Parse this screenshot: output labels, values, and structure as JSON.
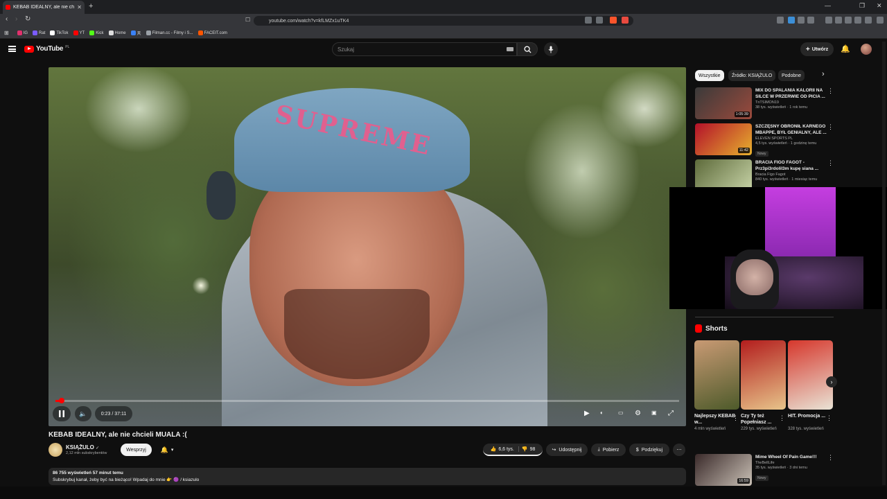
{
  "browser": {
    "tab_title": "KEBAB IDEALNY, ale nie chcie",
    "new_tab": "+",
    "url": "youtube.com/watch?v=kfLMZx1uTK4",
    "win_controls": [
      "—",
      "❐",
      "✕"
    ],
    "bookmarks": [
      {
        "label": "IG",
        "color": "#e1306c"
      },
      {
        "label": "Rat",
        "color": "#7b5cff"
      },
      {
        "label": "TikTok",
        "color": "#ffffff"
      },
      {
        "label": "YT",
        "color": "#ff0000"
      },
      {
        "label": "Kick",
        "color": "#53fc18"
      },
      {
        "label": "Home",
        "color": "#dddddd"
      },
      {
        "label": "天",
        "color": "#3b82f6"
      },
      {
        "label": "Filman.cc - Filmy i S...",
        "color": "#9aa0a6"
      },
      {
        "label": "FACEIT.com",
        "color": "#ff5500"
      }
    ]
  },
  "youtube": {
    "logo_text": "YouTube",
    "region": "PL",
    "search_placeholder": "Szukaj",
    "create_label": "Utwórz"
  },
  "player": {
    "time": "0:23 / 37:11",
    "progress_fraction": 0.0103,
    "beanie_text": "SUPREME"
  },
  "video": {
    "title": "KEBAB IDEALNY, ale nie chcieli MUALA :(",
    "channel": "KSIĄŻULO",
    "verified": "✓",
    "subscribers": "2,12 mln subskrybentów",
    "support_label": "Wesprzyj",
    "likes": "6,6 tys.",
    "dislikes": "98",
    "share_label": "Udostępnij",
    "download_label": "Pobierz",
    "thanks_label": "Podziękuj",
    "more_label": "⋯",
    "views_line": "86 755 wyświetleń  57 minut temu",
    "description": "Subskrybuj kanał, żeby być na bieżąco! Wpadaj do mnie 👉 🟣 / ksiazulo"
  },
  "sidebar": {
    "chips": [
      "Wszystkie",
      "Źródło: KSIĄŻULO",
      "Podobne",
      "›"
    ],
    "videos": [
      {
        "title": "MIX DO SPALANIA KALORII NA SILCE W PRZERWIE OD PICIA ...",
        "channel": "TnTSIMON19",
        "meta": "38 tys. wyświetleń · 1 rok temu",
        "duration": "1:05:39",
        "badge": "",
        "color1": "#3a3a3a",
        "color2": "#9b4a3c"
      },
      {
        "title": "SZCZĘSNY OBRONIŁ KARNEGO MBAPPE, BYŁ GENIALNY, ALE ...",
        "channel": "ELEVEN SPORTS PL",
        "meta": "4,5 tys. wyświetleń · 1 godzinę temu",
        "duration": "11:42",
        "badge": "Nowy",
        "color1": "#b3102a",
        "color2": "#e7b12e"
      },
      {
        "title": "BRACIA FIGO FAGOT - Prz3pi3rdolil3m kupę siana ...",
        "channel": "Bracia Figo Fagot",
        "meta": "840 tys. wyświetleń · 1 miesiąc temu",
        "duration": "",
        "badge": "",
        "color1": "#5d6a3a",
        "color2": "#c7d3a7"
      }
    ],
    "shorts_title": "Shorts",
    "shorts": [
      {
        "title": "Najlepszy KEBAB w...",
        "views": "4 mln wyświetleń",
        "color1": "#c99a74",
        "color2": "#4d5a2a"
      },
      {
        "title": "Czy Ty też Popełniasz ...",
        "views": "229 tys. wyświetleń",
        "color1": "#b31d1d",
        "color2": "#e7c48a"
      },
      {
        "title": "HIT. Promocja ...",
        "views": "328 tys. wyświetleń",
        "color1": "#d6372c",
        "color2": "#e9e3d5"
      }
    ],
    "bottom_video": {
      "title": "Mime Wheel Of Pain Game!!!",
      "channel": "TheBellLife",
      "meta": "35 tys. wyświetleń · 3 dni temu",
      "duration": "16:59",
      "badge": "Nowy",
      "color1": "#3a2a2a",
      "color2": "#c9c0b5"
    }
  }
}
